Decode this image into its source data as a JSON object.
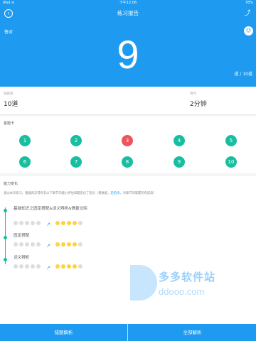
{
  "status_bar": {
    "carrier": "iPad ≋",
    "time": "下午12:06",
    "battery": "78%"
  },
  "nav": {
    "title": "练习报告"
  },
  "hero": {
    "correct_label": "答对",
    "score": "9",
    "unit": "道 / 10道"
  },
  "stats": [
    {
      "key": "做题量",
      "value": "10道"
    },
    {
      "key": "用时",
      "value": "2分钟"
    }
  ],
  "answers": {
    "label": "答题卡",
    "items": [
      {
        "num": "1",
        "status": "correct"
      },
      {
        "num": "2",
        "status": "correct"
      },
      {
        "num": "3",
        "status": "wrong"
      },
      {
        "num": "4",
        "status": "correct"
      },
      {
        "num": "5",
        "status": "correct"
      },
      {
        "num": "6",
        "status": "correct"
      },
      {
        "num": "7",
        "status": "correct"
      },
      {
        "num": "8",
        "status": "correct"
      },
      {
        "num": "9",
        "status": "correct"
      },
      {
        "num": "10",
        "status": "correct"
      }
    ]
  },
  "ability": {
    "label": "能力变化",
    "desc_prefix": "通过本次练习，猿猿再次得有有以下章节的能力评估和最变化了变化（看数能，",
    "desc_link": "后后再，",
    "desc_suffix": "对章节的掌握的有提高！",
    "items": [
      {
        "title": "基础知识之固定搭配&词义辨析&情景交际",
        "before": [
          0,
          0,
          0,
          0,
          0
        ],
        "after": [
          1,
          1,
          1,
          1,
          0
        ]
      },
      {
        "title": "固定搭配",
        "before": [
          0,
          0,
          0,
          0,
          0
        ],
        "after": [
          1,
          1,
          1,
          1,
          0
        ]
      },
      {
        "title": "词义辨析",
        "before": [
          0,
          0,
          0,
          0,
          0
        ],
        "after": [
          1,
          1,
          1,
          1,
          0
        ]
      }
    ]
  },
  "watermark": {
    "brand": "多多软件站",
    "domain": "ddooo.com"
  },
  "bottom": {
    "wrong_label": "错题解析",
    "all_label": "全部解析"
  },
  "colors": {
    "primary": "#1e9bf0",
    "correct": "#17bfa0",
    "wrong": "#f0545a",
    "star": "#ffd33a"
  }
}
